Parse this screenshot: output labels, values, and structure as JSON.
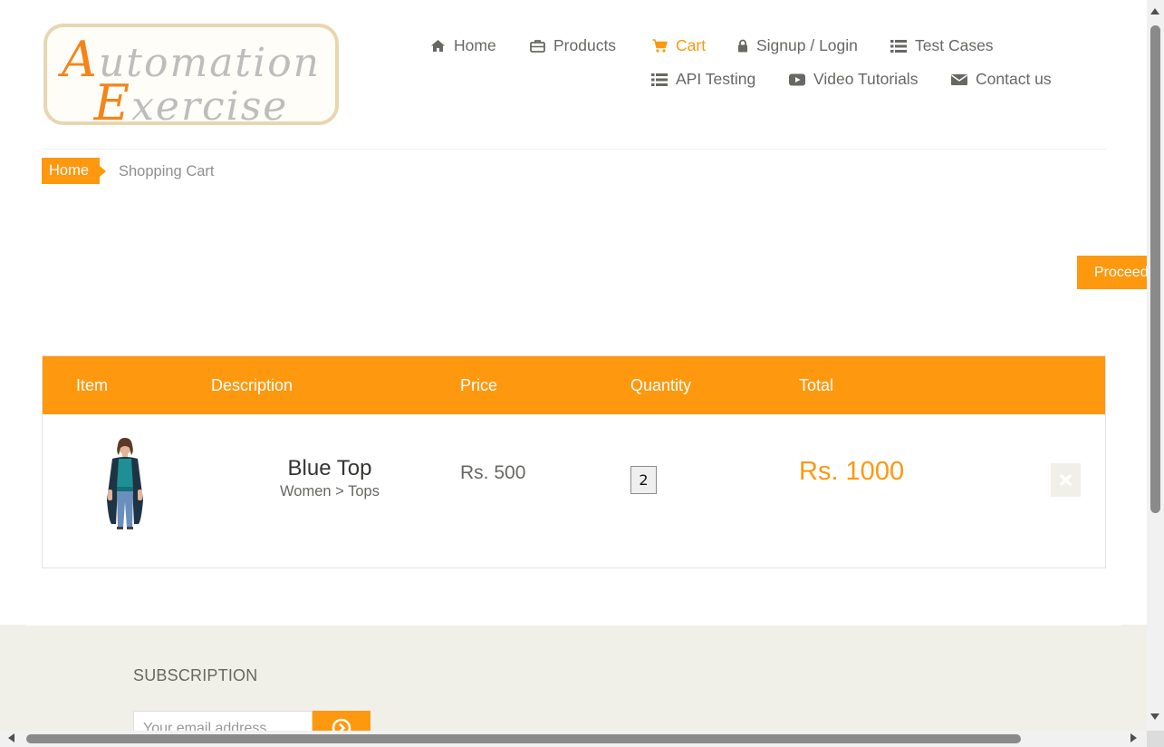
{
  "logo": {
    "line1": "Automation",
    "line2": "Exercise"
  },
  "nav": [
    {
      "label": "Home",
      "icon": "home-icon"
    },
    {
      "label": "Products",
      "icon": "briefcase-icon"
    },
    {
      "label": "Cart",
      "icon": "cart-icon",
      "active": true
    },
    {
      "label": "Signup / Login",
      "icon": "lock-icon"
    },
    {
      "label": "Test Cases",
      "icon": "list-icon"
    },
    {
      "label": "API Testing",
      "icon": "list-icon"
    },
    {
      "label": "Video Tutorials",
      "icon": "youtube-play-icon"
    },
    {
      "label": "Contact us",
      "icon": "envelope-icon"
    }
  ],
  "breadcrumb": {
    "home": "Home",
    "current": "Shopping Cart"
  },
  "proceed_label": "Proceed",
  "cart": {
    "headers": [
      "Item",
      "Description",
      "Price",
      "Quantity",
      "Total"
    ],
    "rows": [
      {
        "name": "Blue Top",
        "category": "Women > Tops",
        "price": "Rs. 500",
        "quantity": "2",
        "total": "Rs. 1000"
      }
    ]
  },
  "subscription": {
    "title": "SUBSCRIPTION",
    "placeholder": "Your email address"
  },
  "colors": {
    "accent": "#fe980f",
    "footer_bg": "#f0f0e9",
    "text": "#696763"
  }
}
